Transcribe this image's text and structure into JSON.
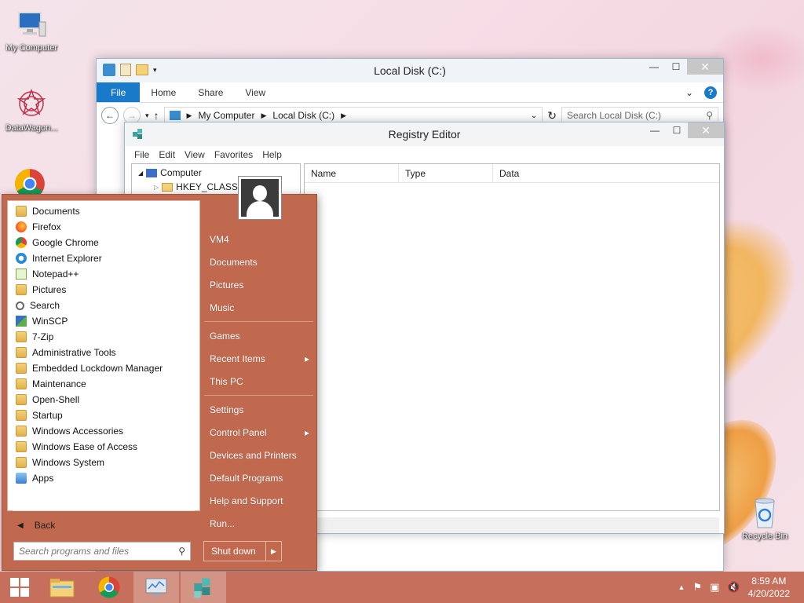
{
  "desktop": {
    "icons": [
      {
        "label": "My Computer"
      },
      {
        "label": "DataWagon..."
      },
      {
        "label": "Recycle Bin"
      }
    ]
  },
  "explorer": {
    "title": "Local Disk (C:)",
    "tabs": [
      "File",
      "Home",
      "Share",
      "View"
    ],
    "address": [
      "My Computer",
      "Local Disk (C:)"
    ],
    "search_placeholder": "Search Local Disk (C:)"
  },
  "regedit": {
    "title": "Registry Editor",
    "menu": [
      "File",
      "Edit",
      "View",
      "Favorites",
      "Help"
    ],
    "tree": [
      {
        "label": "Computer"
      },
      {
        "label": "HKEY_CLASSE"
      }
    ],
    "columns": [
      "Name",
      "Type",
      "Data"
    ]
  },
  "startmenu": {
    "programs": [
      {
        "label": "Documents",
        "icon": "documents-folder-icon"
      },
      {
        "label": "Firefox",
        "icon": "firefox-icon"
      },
      {
        "label": "Google Chrome",
        "icon": "chrome-icon"
      },
      {
        "label": "Internet Explorer",
        "icon": "ie-icon"
      },
      {
        "label": "Notepad++",
        "icon": "notepad-icon"
      },
      {
        "label": "Pictures",
        "icon": "pictures-folder-icon"
      },
      {
        "label": "Search",
        "icon": "search-icon"
      },
      {
        "label": "WinSCP",
        "icon": "winscp-icon"
      },
      {
        "label": "7-Zip",
        "icon": "folder-icon"
      },
      {
        "label": "Administrative Tools",
        "icon": "folder-icon"
      },
      {
        "label": "Embedded Lockdown Manager",
        "icon": "folder-icon"
      },
      {
        "label": "Maintenance",
        "icon": "folder-icon"
      },
      {
        "label": "Open-Shell",
        "icon": "folder-icon"
      },
      {
        "label": "Startup",
        "icon": "folder-icon"
      },
      {
        "label": "Windows Accessories",
        "icon": "folder-icon"
      },
      {
        "label": "Windows Ease of Access",
        "icon": "folder-icon"
      },
      {
        "label": "Windows System",
        "icon": "folder-icon"
      },
      {
        "label": "Apps",
        "icon": "apps-icon"
      }
    ],
    "back_label": "Back",
    "search_placeholder": "Search programs and files",
    "right_items": [
      {
        "label": "VM4",
        "arrow": false,
        "sep_after": false
      },
      {
        "label": "Documents",
        "arrow": false,
        "sep_after": false
      },
      {
        "label": "Pictures",
        "arrow": false,
        "sep_after": false
      },
      {
        "label": "Music",
        "arrow": false,
        "sep_after": true
      },
      {
        "label": "Games",
        "arrow": false,
        "sep_after": false
      },
      {
        "label": "Recent Items",
        "arrow": true,
        "sep_after": false
      },
      {
        "label": "This PC",
        "arrow": false,
        "sep_after": true
      },
      {
        "label": "Settings",
        "arrow": false,
        "sep_after": false
      },
      {
        "label": "Control Panel",
        "arrow": true,
        "sep_after": false
      },
      {
        "label": "Devices and Printers",
        "arrow": false,
        "sep_after": false
      },
      {
        "label": "Default Programs",
        "arrow": false,
        "sep_after": false
      },
      {
        "label": "Help and Support",
        "arrow": false,
        "sep_after": false
      },
      {
        "label": "Run...",
        "arrow": false,
        "sep_after": false
      }
    ],
    "shutdown_label": "Shut down"
  },
  "taskbar": {
    "clock_time": "8:59 AM",
    "clock_date": "4/20/2022"
  },
  "colors": {
    "accent": "#c0694f",
    "taskbar": "#c56f5c",
    "ribbon_file": "#1979ca"
  }
}
